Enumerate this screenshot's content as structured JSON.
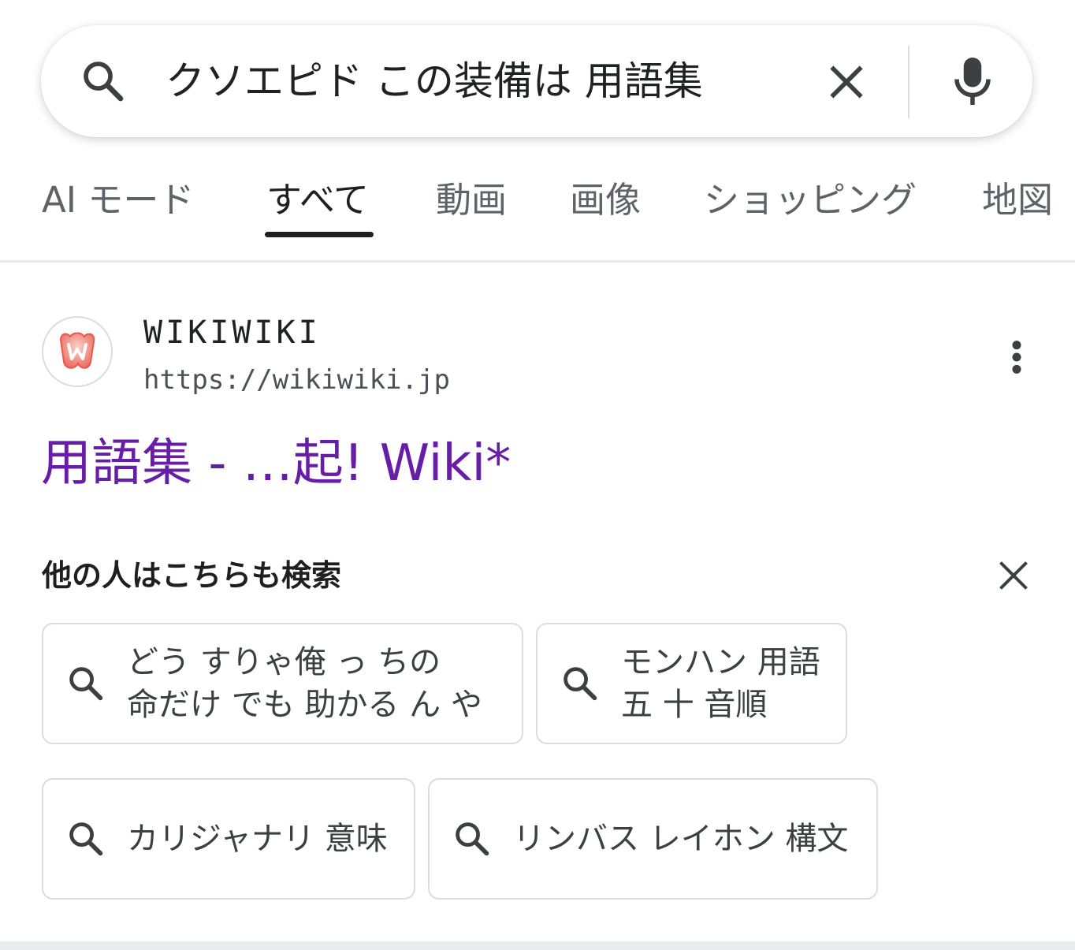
{
  "search": {
    "query": "クソエピド この装備は 用語集",
    "icons": {
      "search": "search-icon",
      "clear": "close-icon",
      "voice": "microphone-icon"
    }
  },
  "tabs": [
    {
      "label": "AI モード",
      "active": false
    },
    {
      "label": "すべて",
      "active": true
    },
    {
      "label": "動画",
      "active": false
    },
    {
      "label": "画像",
      "active": false
    },
    {
      "label": "ショッピング",
      "active": false
    },
    {
      "label": "地図",
      "active": false
    }
  ],
  "result": {
    "site_name": "WIKIWIKI",
    "url": "https://wikiwiki.jp",
    "title": "用語集 - …起! Wiki*",
    "title_color": "#681da8",
    "menu_icon": "more-vert-icon"
  },
  "related": {
    "heading": "他の人はこちらも検索",
    "chips": [
      {
        "lines": [
          "どう すりゃ俺 っ ちの",
          "命だけ でも 助かる ん や"
        ]
      },
      {
        "lines": [
          "モンハン 用語",
          "五 十 音順"
        ]
      },
      {
        "lines": [
          "カリジャナリ 意味"
        ]
      },
      {
        "lines": [
          "リンバス レイホン 構文"
        ]
      }
    ]
  }
}
